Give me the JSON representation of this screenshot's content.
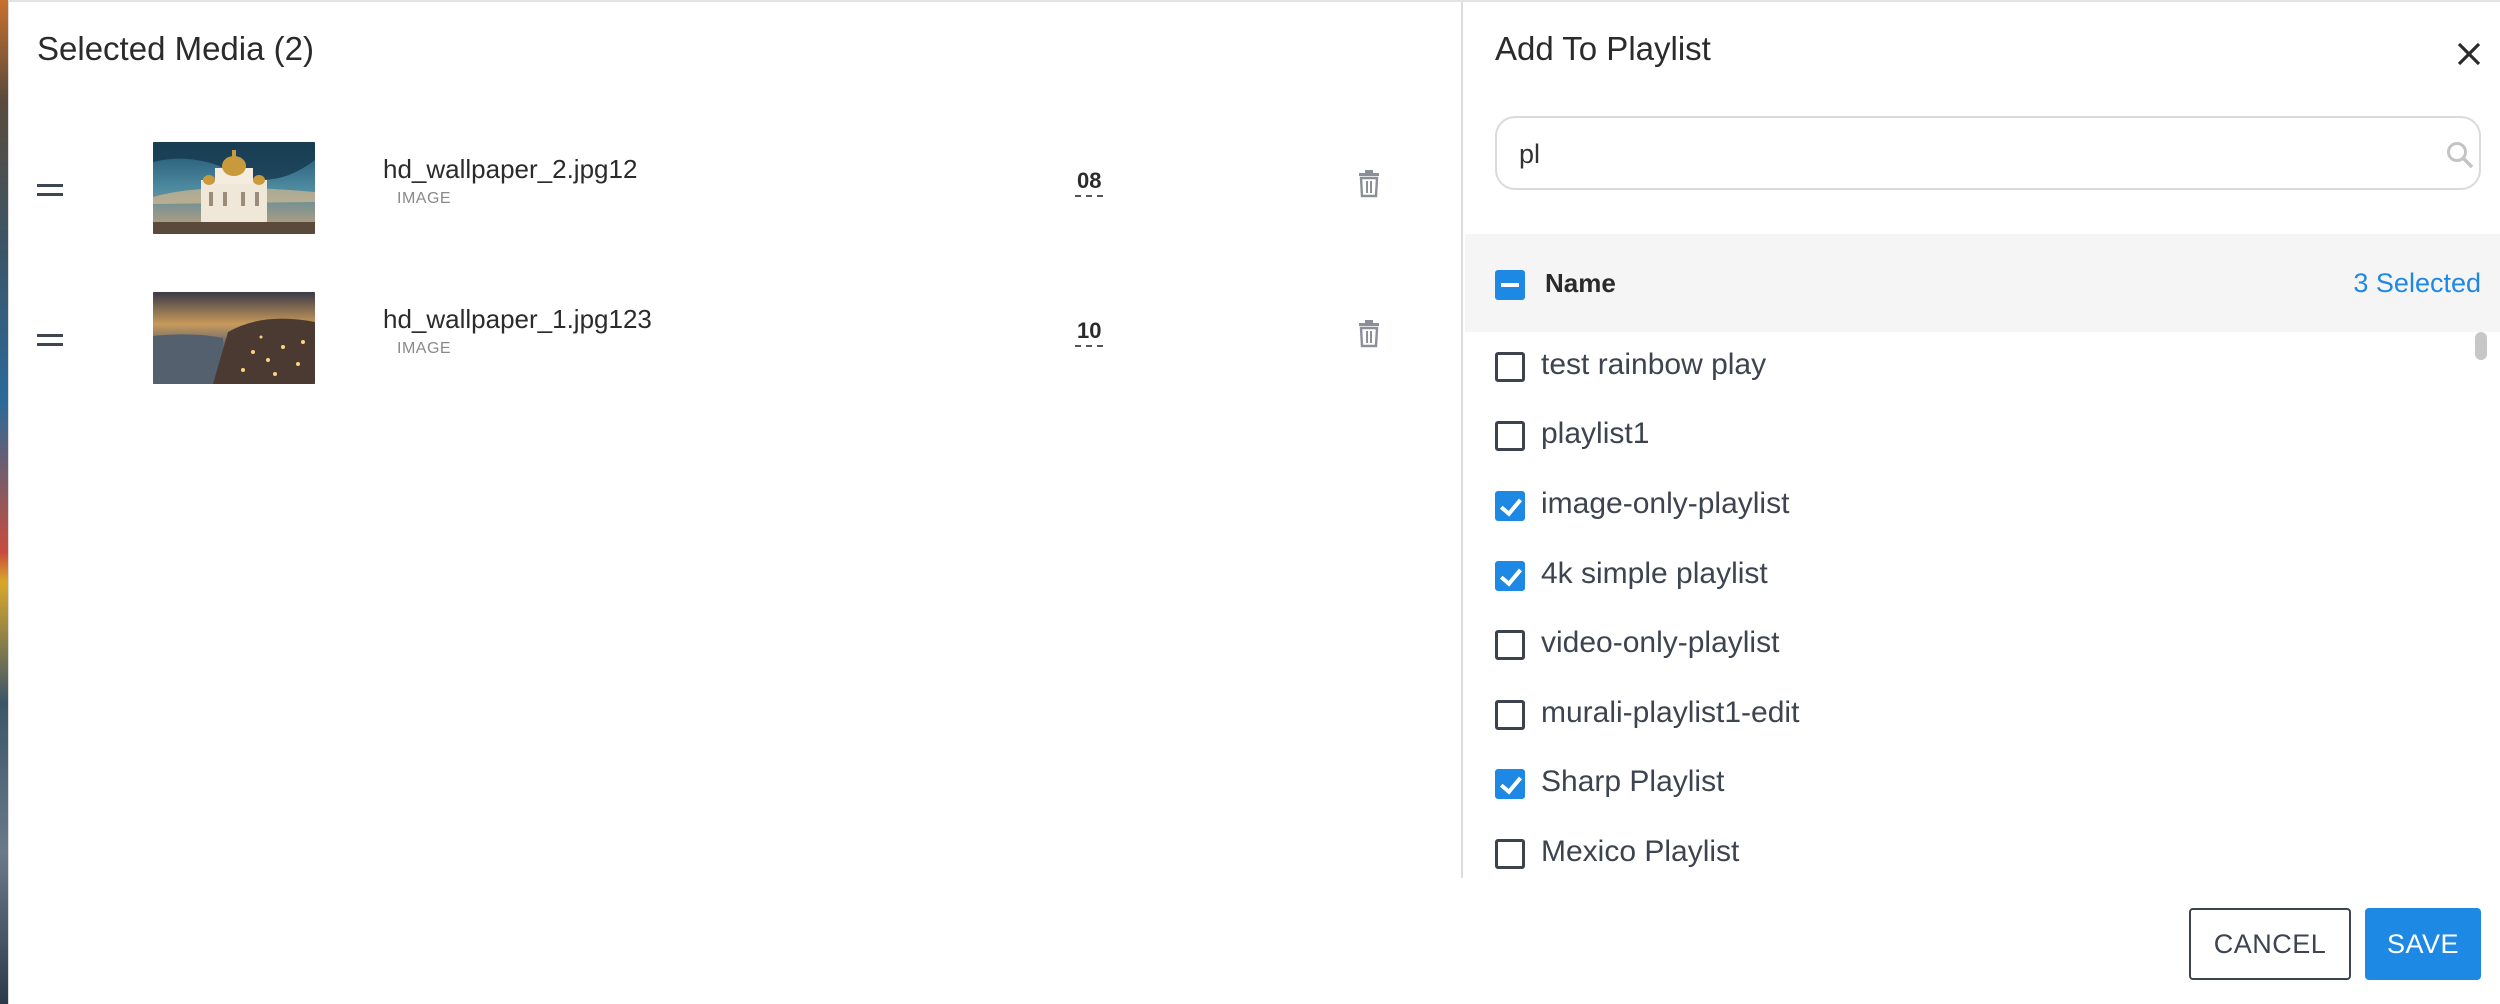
{
  "left": {
    "title": "Selected Media (2)",
    "media": [
      {
        "name": "hd_wallpaper_2.jpg12",
        "type": "IMAGE",
        "duration": "08"
      },
      {
        "name": "hd_wallpaper_1.jpg123",
        "type": "IMAGE",
        "duration": "10"
      }
    ]
  },
  "right": {
    "title": "Add To Playlist",
    "search": {
      "value": "pl",
      "placeholder": ""
    },
    "header": {
      "name": "Name",
      "selected": "3 Selected"
    },
    "playlists": [
      {
        "label": "test rainbow play",
        "checked": false
      },
      {
        "label": "playlist1",
        "checked": false
      },
      {
        "label": "image-only-playlist",
        "checked": true
      },
      {
        "label": "4k simple playlist",
        "checked": true
      },
      {
        "label": "video-only-playlist",
        "checked": false
      },
      {
        "label": "murali-playlist1-edit",
        "checked": false
      },
      {
        "label": "Sharp Playlist",
        "checked": true
      },
      {
        "label": "Mexico Playlist",
        "checked": false
      }
    ],
    "buttons": {
      "cancel": "CANCEL",
      "save": "SAVE"
    }
  },
  "colors": {
    "accent": "#1e88e5",
    "text": "#2b2b2b",
    "header_bg": "#f5f5f5"
  }
}
